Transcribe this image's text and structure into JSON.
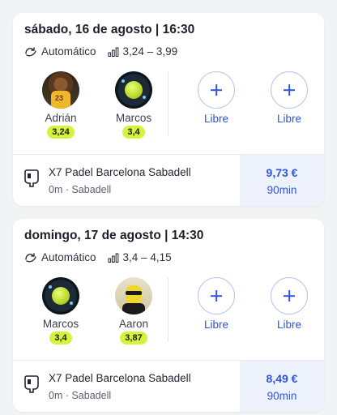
{
  "matches": [
    {
      "title": "sábado, 16 de agosto | 16:30",
      "mode": "Automático",
      "level_range": "3,24 – 3,99",
      "players": [
        {
          "name": "Adrián",
          "level": "3,24",
          "avatar": "player-photo"
        },
        {
          "name": "Marcos",
          "level": "3,4",
          "avatar": "tennis-ball-photo"
        }
      ],
      "open_slots": [
        "Libre",
        "Libre"
      ],
      "venue": {
        "name": "X7 Padel Barcelona Sabadell",
        "detail": "0m · Sabadell"
      },
      "price": "9,73 €",
      "duration": "90min"
    },
    {
      "title": "domingo, 17 de agosto | 14:30",
      "mode": "Automático",
      "level_range": "3,4 – 4,15",
      "players": [
        {
          "name": "Marcos",
          "level": "3,4",
          "avatar": "tennis-ball-photo"
        },
        {
          "name": "Aaron",
          "level": "3,87",
          "avatar": "cartoon-photo"
        }
      ],
      "open_slots": [
        "Libre",
        "Libre"
      ],
      "venue": {
        "name": "X7 Padel Barcelona Sabadell",
        "detail": "0m · Sabadell"
      },
      "price": "8,49 €",
      "duration": "90min"
    }
  ],
  "colors": {
    "accent": "#2f56d6",
    "level_badge": "#d7f23c",
    "price_bg": "#eef2fd"
  },
  "icons": {
    "mode": "auto-swap-icon",
    "level": "signal-bars-icon",
    "venue": "padel-racket-icon",
    "add": "plus-icon"
  }
}
